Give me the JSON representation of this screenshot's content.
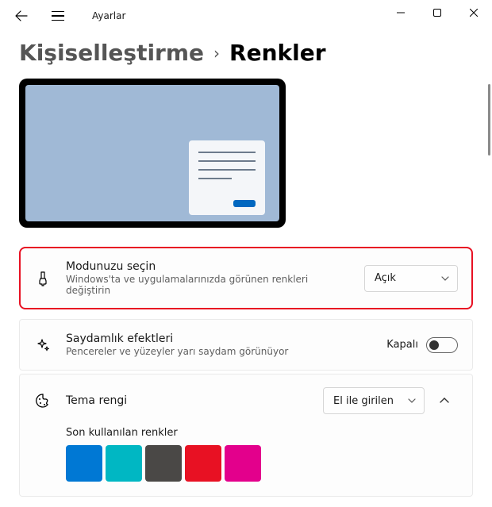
{
  "app_title": "Ayarlar",
  "breadcrumb": {
    "parent": "Kişiselleştirme",
    "current": "Renkler"
  },
  "mode": {
    "title": "Modunuzu seçin",
    "desc": "Windows'ta ve uygulamalarınızda görünen renkleri değiştirin",
    "selected": "Açık"
  },
  "transparency": {
    "title": "Saydamlık efektleri",
    "desc": "Pencereler ve yüzeyler yarı saydam görünüyor",
    "state_label": "Kapalı"
  },
  "accent": {
    "title": "Tema rengi",
    "selected": "El ile girilen",
    "recent_label": "Son kullanılan renkler",
    "recent_colors": [
      "#0078d4",
      "#00b7c3",
      "#4a4846",
      "#e81123",
      "#e3008c"
    ]
  }
}
